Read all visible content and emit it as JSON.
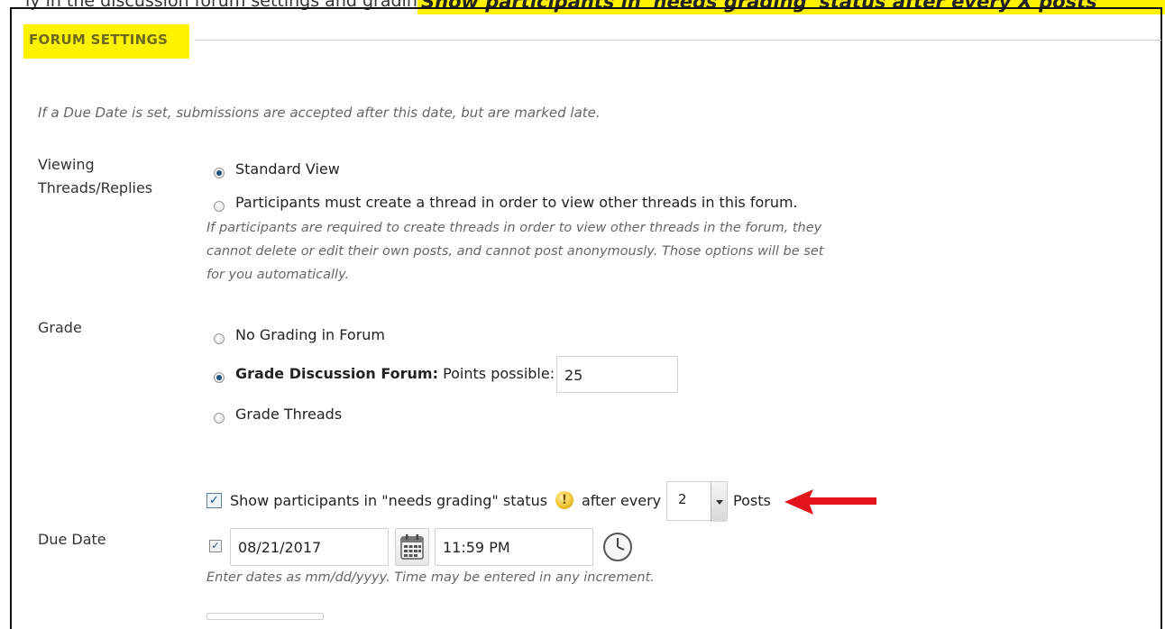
{
  "top_fragment": {
    "text": "ly in the discussion forum settings and grading",
    "highlight": "Show participants in 'needs grading' status after every X posts"
  },
  "section": {
    "title": "FORUM SETTINGS",
    "note": "If a Due Date is set, submissions are accepted after this date, but are marked late."
  },
  "viewing": {
    "label_line1": "Viewing",
    "label_line2": "Threads/Replies",
    "option_standard": "Standard View",
    "option_participants": "Participants must create a thread in order to view other threads in this forum.",
    "help_line1": "If participants are required to create threads in order to view other threads in the forum, they",
    "help_line2": "cannot delete or edit their own posts, and cannot post anonymously. Those options will be set",
    "help_line3": "for you automatically.",
    "selected": "Standard View"
  },
  "grade": {
    "label": "Grade",
    "option_none": "No Grading in Forum",
    "option_forum_bold": "Grade Discussion Forum:",
    "option_forum_points_label": "Points possible:",
    "points_value": "25",
    "option_threads": "Grade Threads",
    "selected": "Grade Discussion Forum"
  },
  "needs_grading": {
    "checked": true,
    "checkbox_mark": "✓",
    "text_before": "Show participants in \"needs grading\" status",
    "text_after": "after every",
    "posts_value": "2",
    "text_posts": "Posts",
    "warning_glyph": "!"
  },
  "due_date": {
    "label": "Due Date",
    "checked": true,
    "checkbox_mark": "✓",
    "date_value": "08/21/2017",
    "time_value": "11:59 PM",
    "help": "Enter dates as mm/dd/yyyy. Time may be entered in any increment."
  },
  "colors": {
    "highlight": "#fff200",
    "arrow": "#e3141b",
    "accent": "#1f4f7a"
  }
}
